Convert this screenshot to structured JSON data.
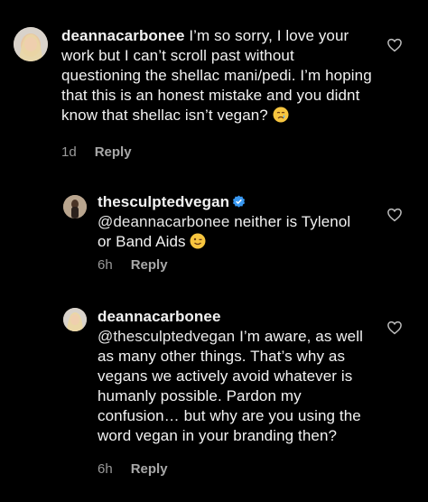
{
  "comments": [
    {
      "username": "deannacarbonee",
      "text": "I’m so sorry, I love your work but I can’t scroll past without questioning the shellac mani/pedi. I’m hoping that this is an honest mistake and you didnt know that shellac isn’t vegan?",
      "emoji": "crying-face",
      "time": "1d",
      "reply_label": "Reply",
      "like_icon": "heart-outline-icon"
    },
    {
      "username": "thesculptedvegan",
      "verified": true,
      "mention": "@deannacarbonee",
      "text": "neither is Tylenol or Band Aids",
      "emoji": "winking-face",
      "time": "6h",
      "reply_label": "Reply",
      "like_icon": "heart-outline-icon"
    },
    {
      "username": "deannacarbonee",
      "mention": "@thesculptedvegan",
      "text": "I’m aware, as well as many other things. That’s why as vegans we actively avoid whatever is humanly possible. Pardon my confusion… but why are you using the word vegan in your branding then?",
      "time": "6h",
      "reply_label": "Reply",
      "like_icon": "heart-outline-icon"
    }
  ],
  "colors": {
    "background": "#000000",
    "text": "#f2f2f2",
    "meta": "#9a9a9a",
    "verified": "#3897f0"
  }
}
